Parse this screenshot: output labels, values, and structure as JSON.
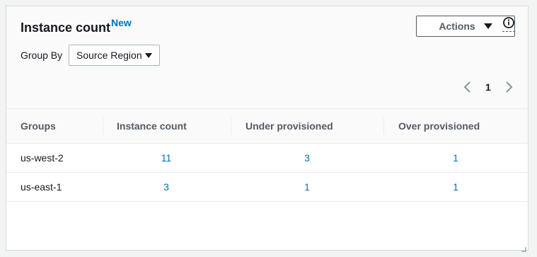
{
  "widget": {
    "title": "Instance count",
    "badge": "New",
    "actions_label": "Actions",
    "group_by_label": "Group By",
    "group_by_value": "Source Region",
    "pagination": {
      "current_page": "1"
    }
  },
  "table": {
    "headers": [
      "Groups",
      "Instance count",
      "Under provisioned",
      "Over provisioned"
    ],
    "rows": [
      {
        "group": "us-west-2",
        "instance_count": "11",
        "under_provisioned": "3",
        "over_provisioned": "1"
      },
      {
        "group": "us-east-1",
        "instance_count": "3",
        "under_provisioned": "1",
        "over_provisioned": "1"
      }
    ]
  },
  "colors": {
    "link": "#0073bb",
    "header_text": "#545b64",
    "border": "#eaeded"
  }
}
